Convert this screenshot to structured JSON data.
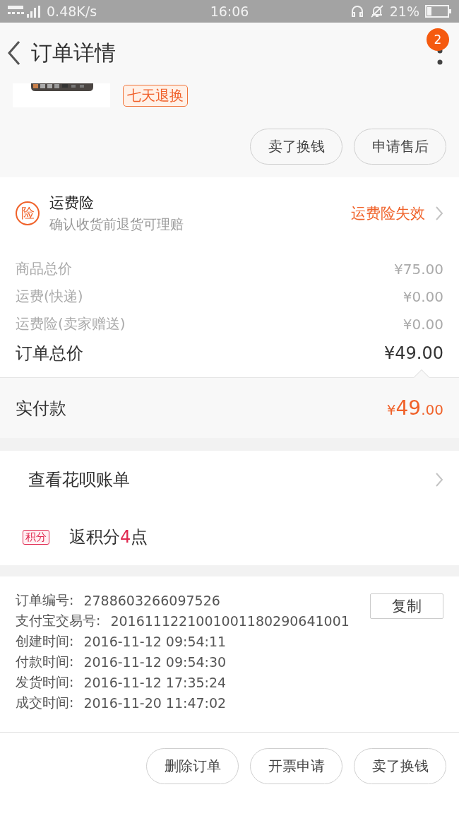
{
  "status_bar": {
    "network_speed": "0.48K/s",
    "time": "16:06",
    "battery_percent": "21%"
  },
  "header": {
    "title": "订单详情",
    "badge": "2"
  },
  "product": {
    "tag": "七天退换"
  },
  "product_actions": [
    "卖了换钱",
    "申请售后"
  ],
  "insurance": {
    "icon_text": "险",
    "title": "运费险",
    "subtitle": "确认收货前退货可理赔",
    "status": "运费险失效"
  },
  "price_lines": [
    {
      "label": "商品总价",
      "value": "¥75.00",
      "kind": "minor"
    },
    {
      "label": "运费(快递)",
      "value": "¥0.00",
      "kind": "minor"
    },
    {
      "label": "运费险(卖家赠送)",
      "value": "¥0.00",
      "kind": "minor"
    },
    {
      "label": "订单总价",
      "value": "¥49.00",
      "kind": "total"
    }
  ],
  "paid": {
    "label": "实付款",
    "currency": "¥",
    "integer": "49",
    "decimal": ".00"
  },
  "huabei": {
    "label": "查看花呗账单"
  },
  "points": {
    "badge": "积分",
    "prefix": "返积分",
    "count": "4",
    "suffix": "点"
  },
  "order_info": [
    {
      "label": "订单编号:",
      "value": "2788603266097526"
    },
    {
      "label": "支付宝交易号:",
      "value": "2016111221001001180290641001"
    },
    {
      "label": "创建时间:",
      "value": "2016-11-12 09:54:11"
    },
    {
      "label": "付款时间:",
      "value": "2016-11-12 09:54:30"
    },
    {
      "label": "发货时间:",
      "value": "2016-11-12 17:35:24"
    },
    {
      "label": "成交时间:",
      "value": "2016-11-20 11:47:02"
    }
  ],
  "copy_button": "复制",
  "bottom_actions": [
    "删除订单",
    "开票申请",
    "卖了换钱"
  ]
}
